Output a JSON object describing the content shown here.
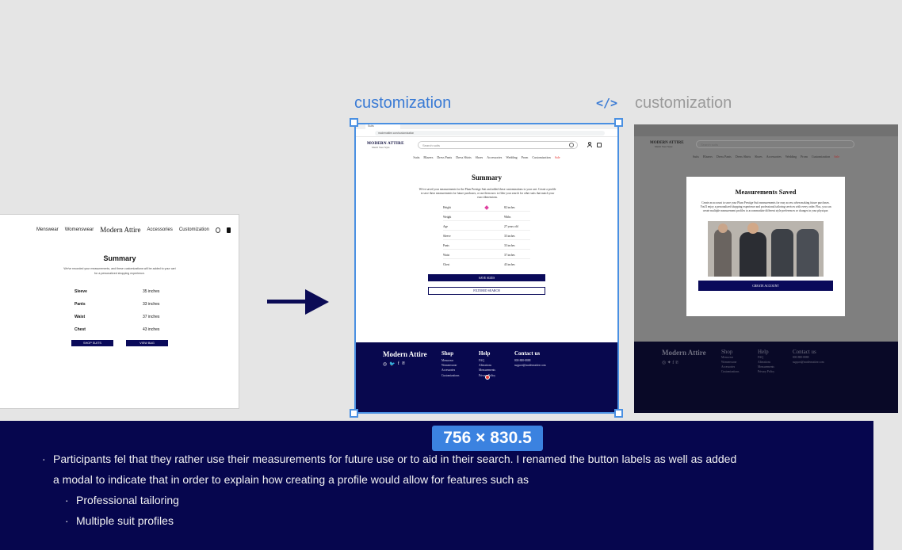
{
  "frame_labels": {
    "center": "customization",
    "right": "customization",
    "code_icon": "</>"
  },
  "colors": {
    "selection": "#4a90e2",
    "selection_label": "#3a7bd5",
    "navy": "#08084e",
    "sale": "#e53935",
    "panel_bg": "#06064e"
  },
  "left_card": {
    "nav": [
      "Menswear",
      "Womenswear"
    ],
    "brand": "Modern Attire",
    "nav_right": [
      "Accessories",
      "Customization"
    ],
    "icons": [
      "search-icon",
      "bag-icon"
    ],
    "title": "Summary",
    "description": "We've recorded your measurements, and these customizations will be added to your cart for a personalized shopping experience.",
    "rows": [
      {
        "label": "Sleeve",
        "value": "35 inches"
      },
      {
        "label": "Pants",
        "value": "33 inches"
      },
      {
        "label": "Waist",
        "value": "37 inches"
      },
      {
        "label": "Chest",
        "value": "43 inches"
      }
    ],
    "buttons": [
      "SHOP SUITS",
      "VIEW BAG"
    ]
  },
  "center_page": {
    "tab": "Suits",
    "url": "modernattire.com/customization",
    "brand_line1": "MODERN ATTIRE",
    "brand_line2": "Match Your Style",
    "search_placeholder": "Search suits",
    "nav": [
      "Suits",
      "Blazers",
      "Dress Pants",
      "Dress Shirts",
      "Shoes",
      "Accessories",
      "Wedding",
      "Prom",
      "Customization"
    ],
    "nav_sale": "Sale",
    "title": "Summary",
    "description": "We've saved your measurements for the Plum Prestige Suit and added these customizations to your cart. Create a profile to save these measurements for future purchases, or use them now to filter your search for other suits that match your exact dimensions.",
    "rows": [
      {
        "label": "Height",
        "value": "82 inches"
      },
      {
        "label": "Weight",
        "value": "Wbbs"
      },
      {
        "label": "Age",
        "value": "27 years old"
      },
      {
        "label": "Sleeve",
        "value": "35 inches"
      },
      {
        "label": "Pants",
        "value": "33 inches"
      },
      {
        "label": "Waist",
        "value": "37 inches"
      },
      {
        "label": "Chest",
        "value": "43 inches"
      }
    ],
    "save_button": "SAVE SIZES",
    "filter_button": "FILTERED SEARCH",
    "footer": {
      "brand": "Modern Attire",
      "social": [
        "◎",
        "🐦",
        "f",
        "℗"
      ],
      "shop_heading": "Shop",
      "shop_items": [
        "Menswear",
        "Womenswear",
        "Accessories",
        "Customizations"
      ],
      "help_heading": "Help",
      "help_items": [
        "FAQ",
        "Alterations",
        "Measurements",
        "Privacy Policy"
      ],
      "contact_heading": "Contact us",
      "contact_items": [
        "800-888-8888",
        "support@modernattire.com"
      ]
    }
  },
  "right_page": {
    "brand_line1": "MODERN ATTIRE",
    "brand_line2": "Match Your Style",
    "search_placeholder": "Search suits",
    "nav": [
      "Suits",
      "Blazers",
      "Dress Pants",
      "Dress Shirts",
      "Shoes",
      "Accessories",
      "Wedding",
      "Prom",
      "Customization"
    ],
    "nav_sale": "Sale",
    "modal_title": "Measurements Saved",
    "modal_description": "Create an account to save your Plum Prestige Suit measurements for easy access when making future purchases. You'll enjoy a personalized shopping experience and professional tailoring services with every order. Plus, you can create multiple measurement profiles to accommodate different style preferences or changes in your physique.",
    "modal_button": "CREATE ACCOUNT",
    "footer": {
      "brand": "Modern Attire",
      "shop_heading": "Shop",
      "shop_items": [
        "Menswear",
        "Womenswear",
        "Accessories",
        "Customizations"
      ],
      "help_heading": "Help",
      "help_items": [
        "FAQ",
        "Alterations",
        "Measurements",
        "Privacy Policy"
      ],
      "contact_heading": "Contact us",
      "contact_items": [
        "800-888-8888",
        "support@modernattire.com"
      ]
    }
  },
  "dimension_badge": "756 × 830.5",
  "notes": {
    "main_line1": "Participants fel that they rather use their measurements for future use or to aid in their search. I renamed the button labels as well as added",
    "main_line2": "a modal to indicate that in order to explain how creating a profile would allow for features such as",
    "sub_items": [
      "Professional tailoring",
      "Multiple suit profiles"
    ]
  }
}
